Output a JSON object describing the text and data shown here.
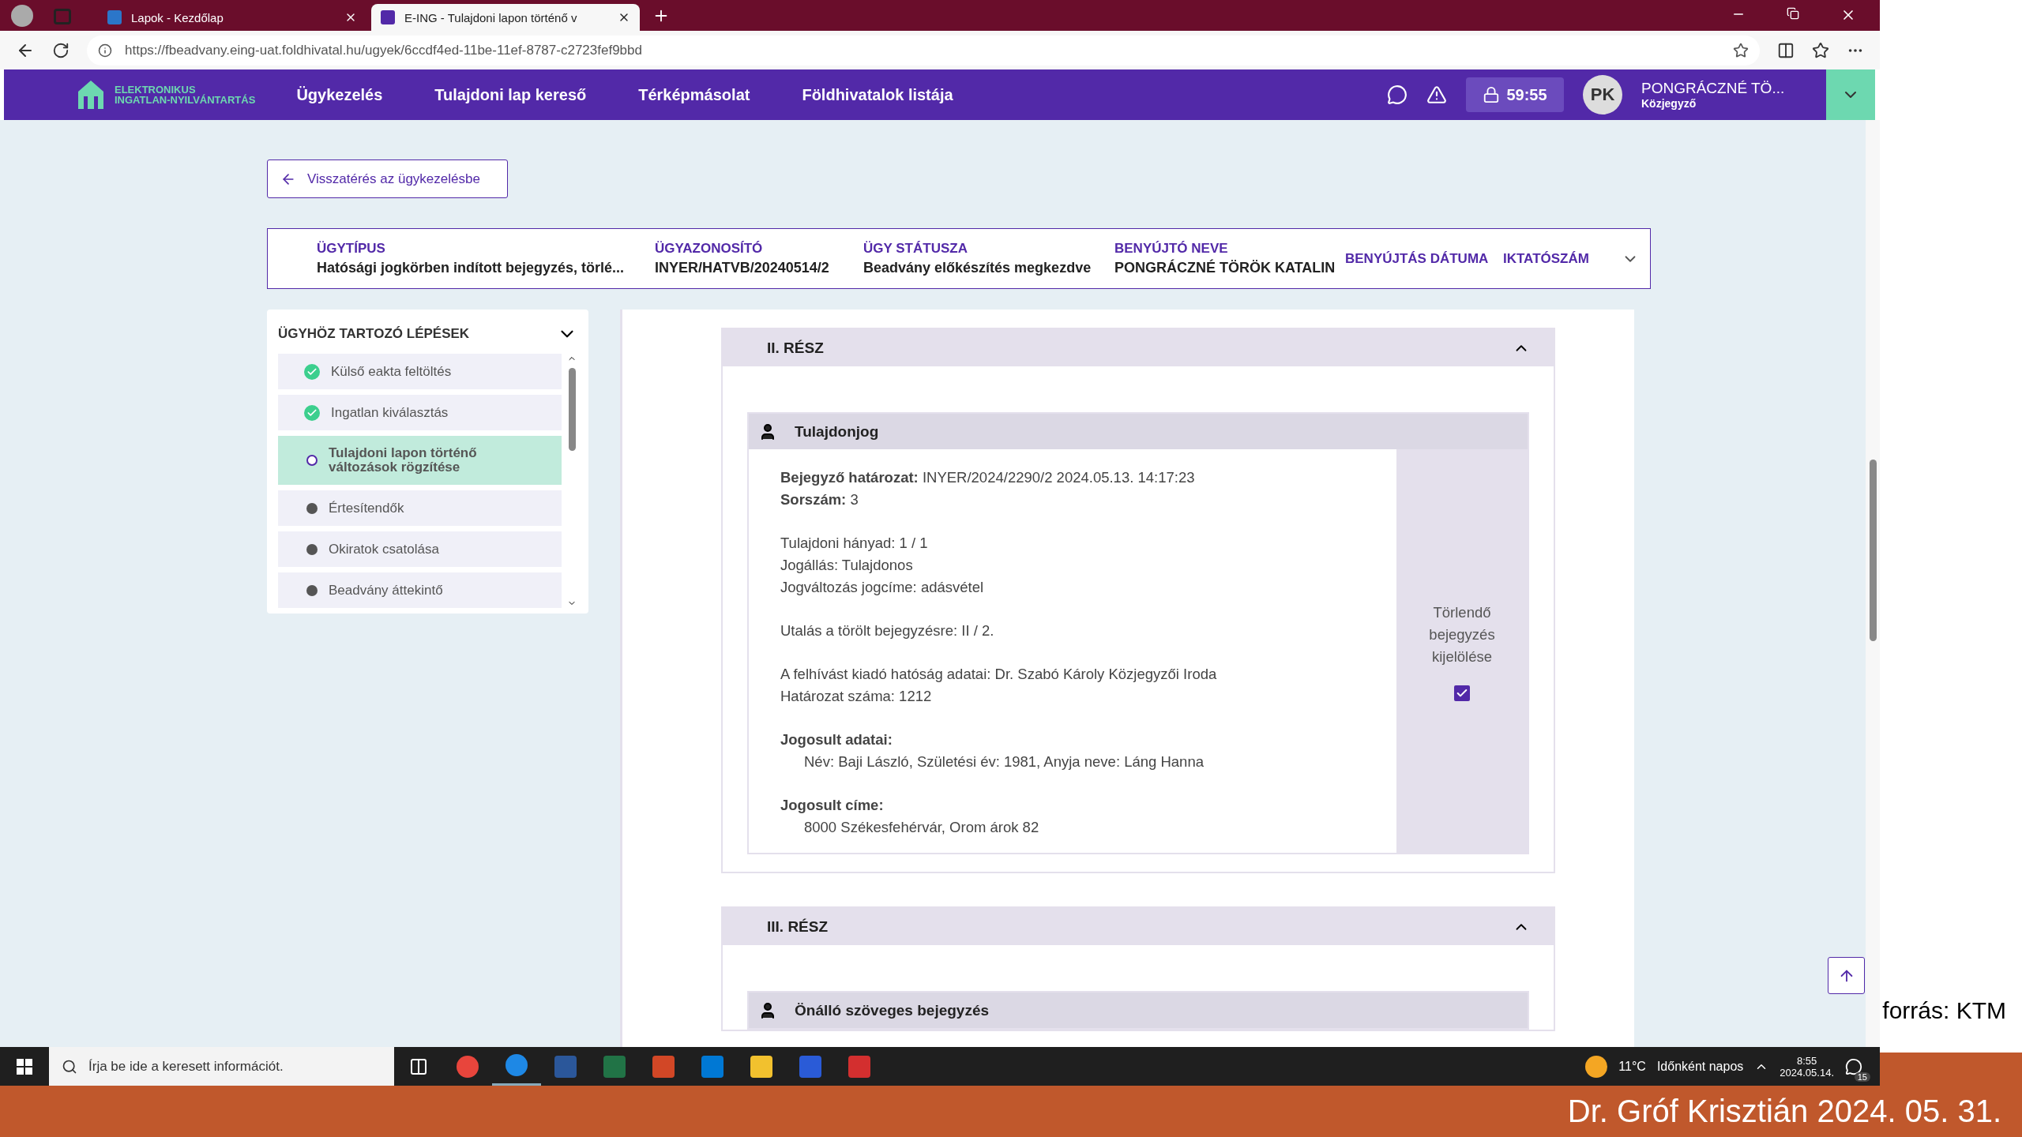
{
  "browser": {
    "tabs": [
      {
        "title": "Lapok - Kezdőlap",
        "selected": false
      },
      {
        "title": "E-ING - Tulajdoni lapon történő v",
        "selected": true
      }
    ],
    "url": "https://fbeadvany.eing-uat.foldhivatal.hu/ugyek/6ccdf4ed-11be-11ef-8787-c2723fef9bbd"
  },
  "header": {
    "logo_lines": [
      "ELEKTRONIKUS",
      "INGATLAN-NYILVÁNTARTÁS"
    ],
    "nav": [
      "Ügykezelés",
      "Tulajdoni lap kereső",
      "Térképmásolat",
      "Földhivatalok listája"
    ],
    "timer": "59:55",
    "avatar": "PK",
    "user_name": "PONGRÁCZNÉ TÖ...",
    "user_role": "Közjegyző"
  },
  "back_button": "Visszatérés az ügykezelésbe",
  "case_info": [
    {
      "label": "ÜGYTÍPUS",
      "value": "Hatósági jogkörben indított bejegyzés, törlé..."
    },
    {
      "label": "ÜGYAZONOSÍTÓ",
      "value": "INYER/HATVB/20240514/2"
    },
    {
      "label": "ÜGY STÁTUSZA",
      "value": "Beadvány előkészítés megkezdve"
    },
    {
      "label": "BENYÚJTÓ NEVE",
      "value": "PONGRÁCZNÉ TÖRÖK KATALIN"
    },
    {
      "label": "BENYÚJTÁS DÁTUMA"
    },
    {
      "label": "IKTATÓSZÁM"
    }
  ],
  "steps": {
    "title": "ÜGYHÖZ TARTOZÓ LÉPÉSEK",
    "items": [
      {
        "label": "Külső eakta feltöltés",
        "kind": "done",
        "selected": false
      },
      {
        "label": "Ingatlan kiválasztás",
        "kind": "done",
        "selected": false
      },
      {
        "label": "Tulajdoni lapon történő változások rögzítése",
        "kind": "current",
        "selected": true
      },
      {
        "label": "Értesítendők",
        "kind": "pending",
        "selected": false
      },
      {
        "label": "Okiratok csatolása",
        "kind": "pending",
        "selected": false
      },
      {
        "label": "Beadvány áttekintő",
        "kind": "pending",
        "selected": false
      }
    ]
  },
  "sections": [
    {
      "title": "II. RÉSZ",
      "expanded": true,
      "entry": {
        "title": "Tulajdonjog",
        "side_label": "Törlendő bejegyzés kijelölése",
        "checked": true,
        "blocks": [
          [
            {
              "kind": "field",
              "label": "Bejegyző határozat:",
              "value": "INYER/2024/2290/2 2024.05.13. 14:17:23"
            },
            {
              "kind": "field",
              "label": "Sorszám:",
              "value": "3"
            }
          ],
          [
            {
              "kind": "text",
              "text": "Tulajdoni hányad: 1 / 1"
            },
            {
              "kind": "text",
              "text": "Jogállás: Tulajdonos"
            },
            {
              "kind": "text",
              "text": "Jogváltozás jogcíme: adásvétel"
            }
          ],
          [
            {
              "kind": "text",
              "text": "Utalás a törölt bejegyzésre: II / 2."
            }
          ],
          [
            {
              "kind": "text",
              "text": "A felhívást kiadó hatóság adatai: Dr. Szabó Károly Közjegyzői Iroda"
            },
            {
              "kind": "text",
              "text": "Határozat száma: 1212"
            }
          ],
          [
            {
              "kind": "heading",
              "text": "Jogosult adatai:"
            },
            {
              "kind": "indented",
              "text": "Név: Baji László, Születési év: 1981, Anyja neve: Láng Hanna"
            }
          ],
          [
            {
              "kind": "heading",
              "text": "Jogosult címe:"
            },
            {
              "kind": "indented",
              "text": "8000 Székesfehérvár, Orom árok 82"
            }
          ]
        ]
      }
    },
    {
      "title": "III. RÉSZ",
      "expanded": true,
      "entry": {
        "title": "Önálló szöveges bejegyzés"
      }
    }
  ],
  "taskbar": {
    "search_placeholder": "Írja be ide a keresett információt.",
    "weather": "11°C",
    "weather_text": "Időnként napos",
    "time": "8:55",
    "date": "2024.05.14.",
    "notifications": "15"
  },
  "slide": {
    "source": "forrás: KTM",
    "footer": "Dr. Gróf Krisztián 2024. 05. 31."
  }
}
